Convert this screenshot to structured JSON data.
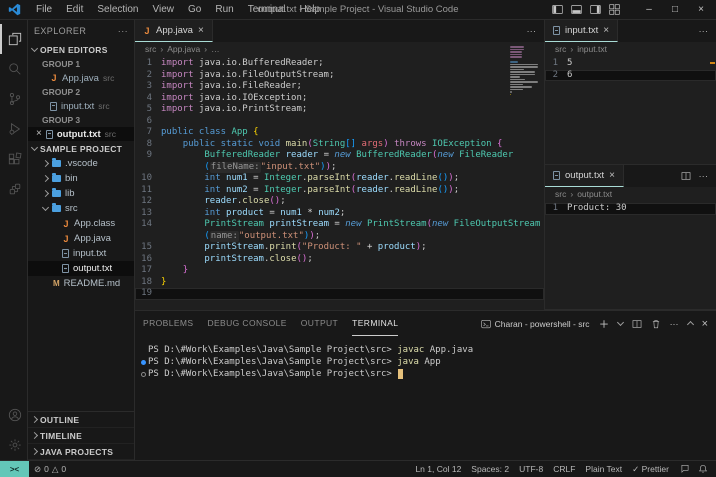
{
  "title_bar": {
    "title": "output.txt - Sample Project - Visual Studio Code",
    "menus": [
      "File",
      "Edit",
      "Selection",
      "View",
      "Go",
      "Run",
      "Terminal",
      "Help"
    ],
    "window_controls": {
      "minimize": "–",
      "maximize": "□",
      "close": "×"
    }
  },
  "activity_bar": {
    "items": [
      "explorer",
      "search",
      "source-control",
      "run-and-debug",
      "extensions",
      "remote-explorer"
    ],
    "bottom_items": [
      "accounts",
      "settings"
    ]
  },
  "sidebar": {
    "title": "EXPLORER",
    "open_editors": {
      "label": "OPEN EDITORS",
      "groups": [
        {
          "label": "GROUP 1",
          "files": [
            {
              "name": "App.java",
              "detail": "src",
              "icon": "java",
              "selected": false
            }
          ]
        },
        {
          "label": "GROUP 2",
          "files": [
            {
              "name": "input.txt",
              "detail": "src",
              "icon": "file",
              "selected": false
            }
          ]
        },
        {
          "label": "GROUP 3",
          "files": [
            {
              "name": "output.txt",
              "detail": "src",
              "icon": "file",
              "selected": true
            }
          ]
        }
      ]
    },
    "project": {
      "label": "SAMPLE PROJECT",
      "items": [
        {
          "name": ".vscode",
          "icon": "folder",
          "depth": 1,
          "chevron": "right",
          "selected": false
        },
        {
          "name": "bin",
          "icon": "folder",
          "depth": 1,
          "chevron": "right",
          "selected": false
        },
        {
          "name": "lib",
          "icon": "folder",
          "depth": 1,
          "chevron": "right",
          "selected": false
        },
        {
          "name": "src",
          "icon": "folder",
          "depth": 1,
          "chevron": "down",
          "selected": false
        },
        {
          "name": "App.class",
          "icon": "java",
          "depth": 2,
          "chevron": "none",
          "selected": false
        },
        {
          "name": "App.java",
          "icon": "java",
          "depth": 2,
          "chevron": "none",
          "selected": false
        },
        {
          "name": "input.txt",
          "icon": "file",
          "depth": 2,
          "chevron": "none",
          "selected": false
        },
        {
          "name": "output.txt",
          "icon": "file",
          "depth": 2,
          "chevron": "none",
          "selected": true
        },
        {
          "name": "README.md",
          "icon": "md",
          "depth": 1,
          "chevron": "none",
          "selected": false
        }
      ]
    },
    "bottom_sections": [
      "OUTLINE",
      "TIMELINE",
      "JAVA PROJECTS"
    ]
  },
  "editor": {
    "tab": "App.java",
    "tab_icon": "java",
    "breadcrumb": [
      "src",
      "App.java",
      "…"
    ],
    "code": [
      {
        "n": "1",
        "seg": [
          [
            "kw",
            "import "
          ],
          [
            "pl",
            "java.io.BufferedReader;"
          ]
        ]
      },
      {
        "n": "2",
        "seg": [
          [
            "kw",
            "import "
          ],
          [
            "pl",
            "java.io.FileOutputStream;"
          ]
        ]
      },
      {
        "n": "3",
        "seg": [
          [
            "kw",
            "import "
          ],
          [
            "pl",
            "java.io.FileReader;"
          ]
        ]
      },
      {
        "n": "4",
        "seg": [
          [
            "kw",
            "import "
          ],
          [
            "pl",
            "java.io.IOException;"
          ]
        ]
      },
      {
        "n": "5",
        "seg": [
          [
            "kw",
            "import "
          ],
          [
            "pl",
            "java.io.PrintStream;"
          ]
        ]
      },
      {
        "n": "6",
        "seg": []
      },
      {
        "n": "7",
        "seg": [
          [
            "st",
            "public class "
          ],
          [
            "ty",
            "App"
          ],
          [
            "pl",
            " "
          ],
          [
            "b1",
            "{"
          ]
        ]
      },
      {
        "n": "8",
        "seg": [
          [
            "pl",
            "    "
          ],
          [
            "st",
            "public static void "
          ],
          [
            "fn",
            "main"
          ],
          [
            "b2",
            "("
          ],
          [
            "ty",
            "String"
          ],
          [
            "b3",
            "[]"
          ],
          [
            "pl",
            " "
          ],
          [
            "pr",
            "args"
          ],
          [
            "b2",
            ")"
          ],
          [
            "pl",
            " "
          ],
          [
            "kw",
            "throws"
          ],
          [
            "pl",
            " "
          ],
          [
            "ty",
            "IOException"
          ],
          [
            "pl",
            " "
          ],
          [
            "b2",
            "{"
          ]
        ]
      },
      {
        "n": "9",
        "seg": [
          [
            "pl",
            "        "
          ],
          [
            "ty",
            "BufferedReader"
          ],
          [
            "pl",
            " "
          ],
          [
            "va",
            "reader"
          ],
          [
            "pl",
            " "
          ],
          [
            "op",
            "="
          ],
          [
            "pl",
            " "
          ],
          [
            "nw",
            "new"
          ],
          [
            "pl",
            " "
          ],
          [
            "ty",
            "BufferedReader"
          ],
          [
            "b2",
            "("
          ],
          [
            "nw",
            "new"
          ],
          [
            "pl",
            " "
          ],
          [
            "ty",
            "FileReader"
          ]
        ]
      },
      {
        "n": "",
        "seg": [
          [
            "pl",
            "        "
          ],
          [
            "b3",
            "("
          ],
          [
            "inlay",
            "fileName:"
          ],
          [
            "str",
            "\"input.txt\""
          ],
          [
            "b3",
            ")"
          ],
          [
            "b2",
            ")"
          ],
          [
            "pl",
            ";"
          ]
        ]
      },
      {
        "n": "10",
        "seg": [
          [
            "pl",
            "        "
          ],
          [
            "st",
            "int"
          ],
          [
            "pl",
            " "
          ],
          [
            "va",
            "num1"
          ],
          [
            "pl",
            " "
          ],
          [
            "op",
            "="
          ],
          [
            "pl",
            " "
          ],
          [
            "ty",
            "Integer"
          ],
          [
            "pl",
            "."
          ],
          [
            "fn",
            "parseInt"
          ],
          [
            "b2",
            "("
          ],
          [
            "va",
            "reader"
          ],
          [
            "pl",
            "."
          ],
          [
            "fn",
            "readLine"
          ],
          [
            "b3",
            "()"
          ],
          [
            "b2",
            ")"
          ],
          [
            "pl",
            ";"
          ]
        ]
      },
      {
        "n": "11",
        "seg": [
          [
            "pl",
            "        "
          ],
          [
            "st",
            "int"
          ],
          [
            "pl",
            " "
          ],
          [
            "va",
            "num2"
          ],
          [
            "pl",
            " "
          ],
          [
            "op",
            "="
          ],
          [
            "pl",
            " "
          ],
          [
            "ty",
            "Integer"
          ],
          [
            "pl",
            "."
          ],
          [
            "fn",
            "parseInt"
          ],
          [
            "b2",
            "("
          ],
          [
            "va",
            "reader"
          ],
          [
            "pl",
            "."
          ],
          [
            "fn",
            "readLine"
          ],
          [
            "b3",
            "()"
          ],
          [
            "b2",
            ")"
          ],
          [
            "pl",
            ";"
          ]
        ]
      },
      {
        "n": "12",
        "seg": [
          [
            "pl",
            "        "
          ],
          [
            "va",
            "reader"
          ],
          [
            "pl",
            "."
          ],
          [
            "fn",
            "close"
          ],
          [
            "b2",
            "()"
          ],
          [
            "pl",
            ";"
          ]
        ]
      },
      {
        "n": "13",
        "seg": [
          [
            "pl",
            "        "
          ],
          [
            "st",
            "int"
          ],
          [
            "pl",
            " "
          ],
          [
            "va",
            "product"
          ],
          [
            "pl",
            " "
          ],
          [
            "op",
            "="
          ],
          [
            "pl",
            " "
          ],
          [
            "va",
            "num1"
          ],
          [
            "pl",
            " "
          ],
          [
            "op",
            "*"
          ],
          [
            "pl",
            " "
          ],
          [
            "va",
            "num2"
          ],
          [
            "pl",
            ";"
          ]
        ]
      },
      {
        "n": "14",
        "seg": [
          [
            "pl",
            "        "
          ],
          [
            "ty",
            "PrintStream"
          ],
          [
            "pl",
            " "
          ],
          [
            "va",
            "printStream"
          ],
          [
            "pl",
            " "
          ],
          [
            "op",
            "="
          ],
          [
            "pl",
            " "
          ],
          [
            "nw",
            "new"
          ],
          [
            "pl",
            " "
          ],
          [
            "ty",
            "PrintStream"
          ],
          [
            "b2",
            "("
          ],
          [
            "nw",
            "new"
          ],
          [
            "pl",
            " "
          ],
          [
            "ty",
            "FileOutputStream"
          ]
        ]
      },
      {
        "n": "",
        "seg": [
          [
            "pl",
            "        "
          ],
          [
            "b3",
            "("
          ],
          [
            "inlay",
            "name:"
          ],
          [
            "str",
            "\"output.txt\""
          ],
          [
            "b3",
            ")"
          ],
          [
            "b2",
            ")"
          ],
          [
            "pl",
            ";"
          ]
        ]
      },
      {
        "n": "15",
        "seg": [
          [
            "pl",
            "        "
          ],
          [
            "va",
            "printStream"
          ],
          [
            "pl",
            "."
          ],
          [
            "fn",
            "print"
          ],
          [
            "b2",
            "("
          ],
          [
            "str",
            "\"Product: \""
          ],
          [
            "pl",
            " "
          ],
          [
            "op",
            "+"
          ],
          [
            "pl",
            " "
          ],
          [
            "va",
            "product"
          ],
          [
            "b2",
            ")"
          ],
          [
            "pl",
            ";"
          ]
        ]
      },
      {
        "n": "16",
        "seg": [
          [
            "pl",
            "        "
          ],
          [
            "va",
            "printStream"
          ],
          [
            "pl",
            "."
          ],
          [
            "fn",
            "close"
          ],
          [
            "b2",
            "()"
          ],
          [
            "pl",
            ";"
          ]
        ]
      },
      {
        "n": "17",
        "seg": [
          [
            "pl",
            "    "
          ],
          [
            "b2",
            "}"
          ]
        ]
      },
      {
        "n": "18",
        "seg": [
          [
            "b1",
            "}"
          ]
        ]
      },
      {
        "n": "19",
        "seg": [],
        "hl": true
      }
    ]
  },
  "right_top": {
    "tab": "input.txt",
    "breadcrumb": [
      "src",
      "input.txt"
    ],
    "lines": [
      {
        "n": "1",
        "text": "5",
        "hl": false
      },
      {
        "n": "2",
        "text": "6",
        "hl": true
      }
    ]
  },
  "right_bottom": {
    "tab": "output.txt",
    "breadcrumb": [
      "src",
      "output.txt"
    ],
    "lines": [
      {
        "n": "1",
        "text": "Product: 30",
        "hl": true
      }
    ]
  },
  "panel": {
    "tabs": [
      "PROBLEMS",
      "DEBUG CONSOLE",
      "OUTPUT",
      "TERMINAL"
    ],
    "active_tab": "TERMINAL",
    "terminal_label": "Charan - powershell - src",
    "terminal_lines": [
      {
        "marker": "none",
        "cursor": false,
        "seg": [
          [
            "tp",
            "PS D:\\#Work\\Examples\\Java\\Sample Project\\src> "
          ],
          [
            "tc",
            "javac"
          ],
          [
            "tp",
            " App.java"
          ]
        ]
      },
      {
        "marker": "dot",
        "cursor": false,
        "seg": [
          [
            "tp",
            "PS D:\\#Work\\Examples\\Java\\Sample Project\\src> "
          ],
          [
            "tc",
            "java"
          ],
          [
            "tp",
            " App"
          ]
        ]
      },
      {
        "marker": "circle",
        "cursor": true,
        "seg": [
          [
            "tp",
            "PS D:\\#Work\\Examples\\Java\\Sample Project\\src> "
          ]
        ]
      }
    ]
  },
  "status_bar": {
    "errors": "0",
    "warnings": "0",
    "error_icon": "⊘",
    "warning_icon": "△",
    "remote_icon": "><",
    "right_items": [
      "Ln 1, Col 12",
      "Spaces: 2",
      "UTF-8",
      "CRLF",
      "Plain Text",
      "✓ Prettier"
    ]
  },
  "icons": {
    "ellipsis": "···",
    "close": "×",
    "split_editor": "split",
    "breadcrumb_sep": "›"
  },
  "colors": {
    "accent_remote_bg": "#63c7b8",
    "tab_underline": "#a9dcd6",
    "terminal_cursor": "#e5c07b",
    "command_dot": "#3794ff",
    "ruler_mark": "#d18616",
    "syntax": {
      "kw": "#c586c0",
      "st": "#569cd6",
      "nw": "#569cd6",
      "ty": "#4ec9b0",
      "fn": "#dcdcaa",
      "va": "#9cdcfe",
      "pr": "#e06c75",
      "str": "#ce9178",
      "pl": "#cccccc",
      "op": "#d4d4d4",
      "b1": "#ffd700",
      "b2": "#da70d6",
      "b3": "#179fff",
      "inlay": "#969696",
      "tp": "#cccccc",
      "tc": "#dcdcaa"
    }
  }
}
